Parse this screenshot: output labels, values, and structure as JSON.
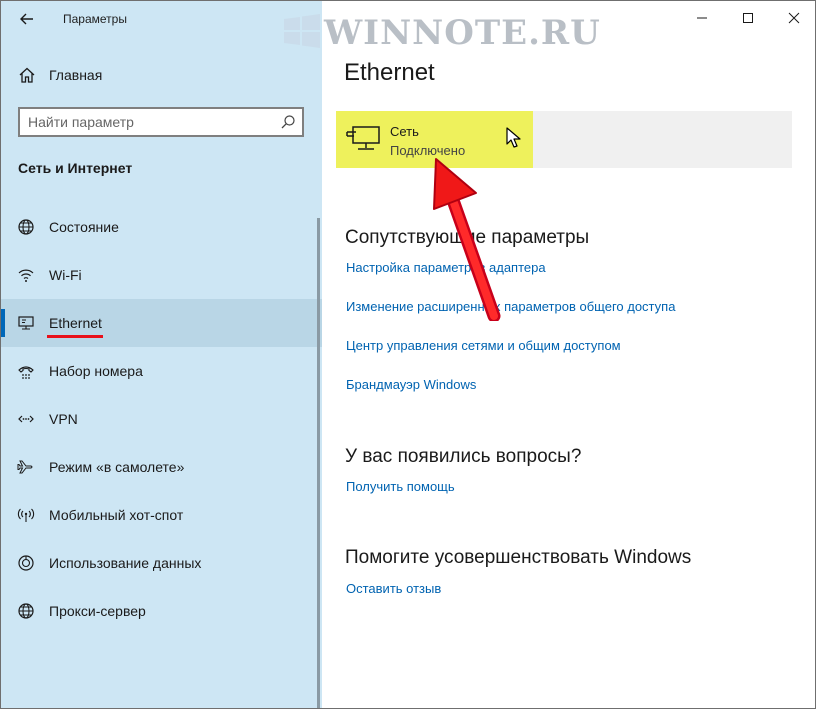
{
  "window": {
    "title": "Параметры"
  },
  "sidebar": {
    "home_label": "Главная",
    "search_placeholder": "Найти параметр",
    "section_title": "Сеть и Интернет",
    "items": [
      {
        "label": "Состояние",
        "icon": "globe-icon"
      },
      {
        "label": "Wi-Fi",
        "icon": "wifi-icon"
      },
      {
        "label": "Ethernet",
        "icon": "ethernet-icon",
        "active": true
      },
      {
        "label": "Набор номера",
        "icon": "dialup-icon"
      },
      {
        "label": "VPN",
        "icon": "vpn-icon"
      },
      {
        "label": "Режим «в самолете»",
        "icon": "airplane-icon"
      },
      {
        "label": "Мобильный хот-спот",
        "icon": "hotspot-icon"
      },
      {
        "label": "Использование данных",
        "icon": "data-usage-icon"
      },
      {
        "label": "Прокси-сервер",
        "icon": "globe-icon"
      }
    ]
  },
  "watermark": {
    "text": "WINNOTE.RU"
  },
  "main": {
    "title": "Ethernet",
    "network": {
      "name": "Сеть",
      "status": "Подключено"
    },
    "related": {
      "heading": "Сопутствующие параметры",
      "links": [
        "Настройка параметров адаптера",
        "Изменение расширенных параметров общего доступа",
        "Центр управления сетями и общим доступом",
        "Брандмауэр Windows"
      ]
    },
    "questions": {
      "heading": "У вас появились вопросы?",
      "link": "Получить помощь"
    },
    "improve": {
      "heading": "Помогите усовершенствовать Windows",
      "link": "Оставить отзыв"
    }
  },
  "colors": {
    "sidebar_bg": "#cde6f4",
    "accent": "#0067b8",
    "link": "#0063b1",
    "highlight": "#eef15c",
    "annotation": "#e8101a"
  }
}
